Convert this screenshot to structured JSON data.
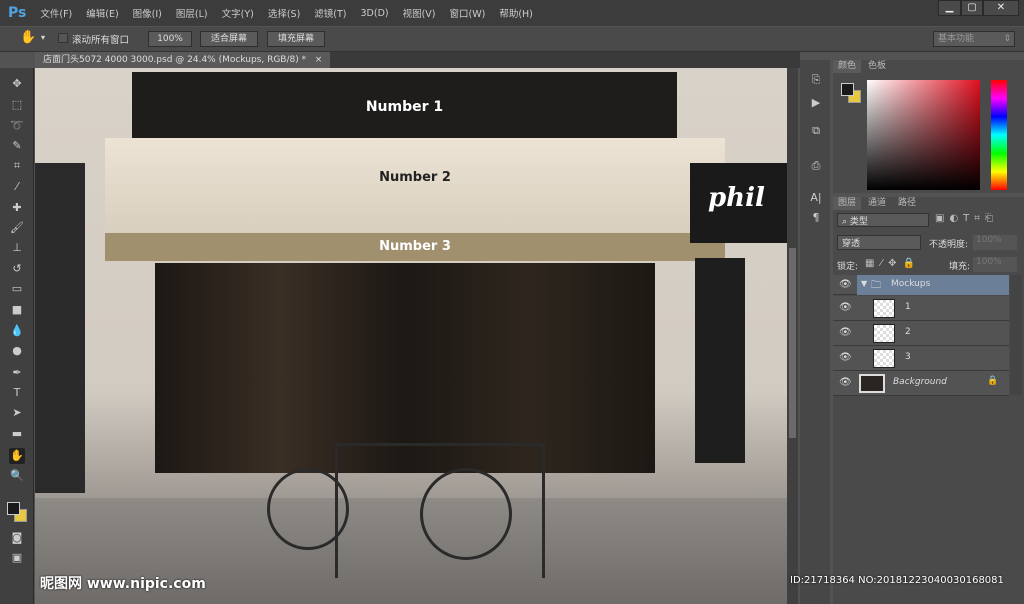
{
  "app": {
    "logo": "Ps"
  },
  "menu": [
    "文件(F)",
    "编辑(E)",
    "图像(I)",
    "图层(L)",
    "文字(Y)",
    "选择(S)",
    "滤镜(T)",
    "3D(D)",
    "视图(V)",
    "窗口(W)",
    "帮助(H)"
  ],
  "window_controls": {
    "minimize": "▁",
    "maximize": "▢",
    "close": "✕"
  },
  "options": {
    "scroll_all": "滚动所有窗口",
    "zoom100": "100%",
    "fit_screen": "适合屏幕",
    "fill_screen": "填充屏幕",
    "workspace": "基本功能"
  },
  "document": {
    "tab": "店面门头5072 4000 3000.psd @ 24.4% (Mockups, RGB/8) *",
    "close": "×"
  },
  "canvas": {
    "sign1": "Number 1",
    "sign2": "Number 2",
    "sign3": "Number 3",
    "shop_sign": "phil"
  },
  "color_panel": {
    "tabs": [
      "颜色",
      "色板"
    ],
    "foreground": "#1a1a1a",
    "background": "#e8c840"
  },
  "layers_panel": {
    "tabs": [
      "图层",
      "通道",
      "路径"
    ],
    "filter": "类型",
    "blend_mode": "穿透",
    "opacity_label": "不透明度:",
    "opacity": "100%",
    "lock_label": "锁定:",
    "fill_label": "填充:",
    "fill": "100%",
    "layers": [
      {
        "name": "Mockups",
        "type": "group"
      },
      {
        "name": "1"
      },
      {
        "name": "2"
      },
      {
        "name": "3"
      },
      {
        "name": "Background",
        "locked": true
      }
    ]
  },
  "watermark": {
    "left": "昵图网 www.nipic.com",
    "right": "ID:21718364 NO:20181223040030168081"
  }
}
